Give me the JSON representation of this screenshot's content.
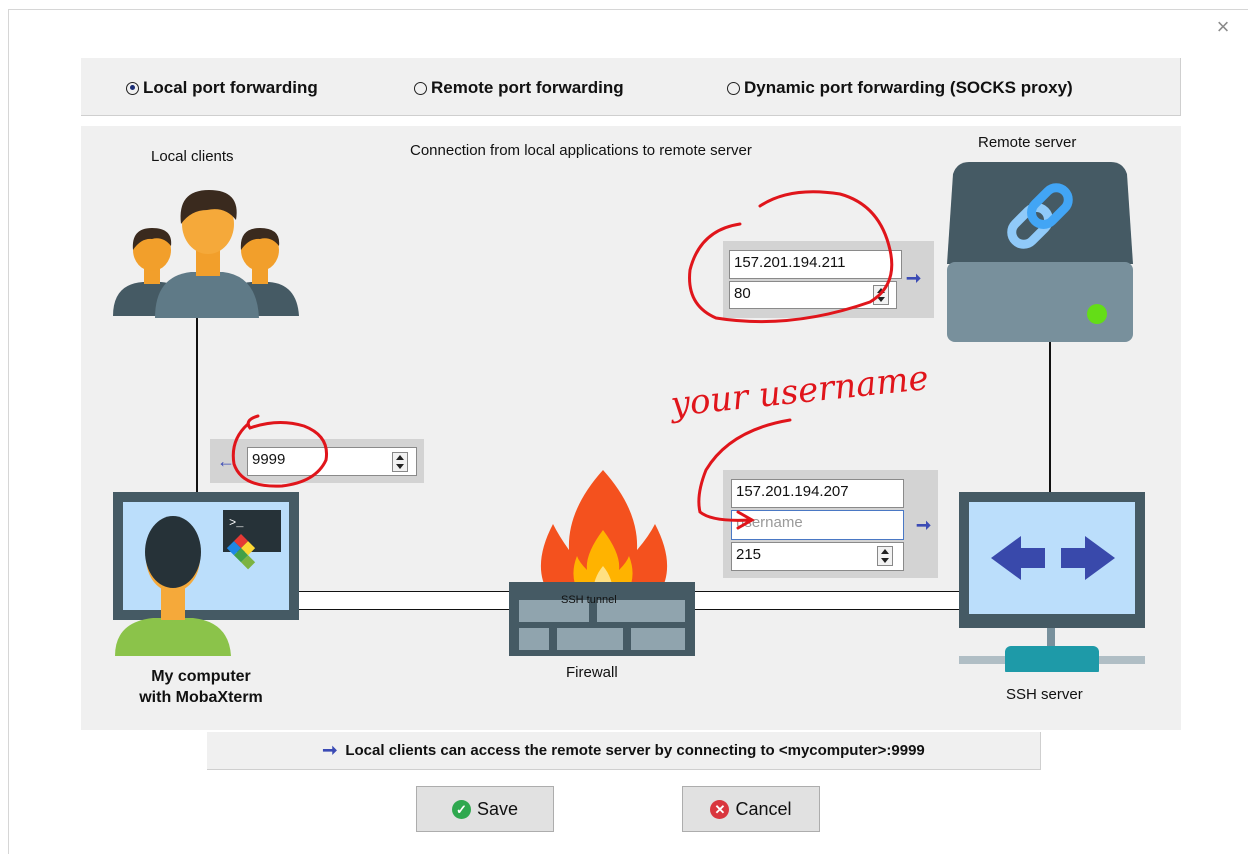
{
  "window": {
    "close_glyph": "×"
  },
  "modes": {
    "local": "Local port forwarding",
    "remote": "Remote port forwarding",
    "dynamic": "Dynamic port forwarding (SOCKS proxy)",
    "selected": "local"
  },
  "diagram": {
    "description": "Connection from local applications to remote server",
    "local_clients_label": "Local clients",
    "remote_server_label": "Remote server",
    "my_computer_label_line1": "My computer",
    "my_computer_label_line2": "with MobaXterm",
    "firewall_label": "Firewall",
    "ssh_server_label": "SSH server",
    "tunnel_label": "SSH tunnel"
  },
  "forwarded_port": {
    "value": "9999"
  },
  "remote": {
    "host": "157.201.194.211",
    "port": "80"
  },
  "ssh": {
    "host": "157.201.194.207",
    "username_placeholder": "username",
    "port": "215"
  },
  "info_text": "Local clients can access the remote server by connecting to <mycomputer>:9999",
  "buttons": {
    "save": "Save",
    "cancel": "Cancel"
  },
  "annotation": {
    "handwriting": "your username"
  },
  "colors": {
    "accent_arrow": "#3b4bb5",
    "annotation_red": "#e0151b",
    "save_green": "#2fa84f",
    "cancel_red": "#d9363e"
  }
}
